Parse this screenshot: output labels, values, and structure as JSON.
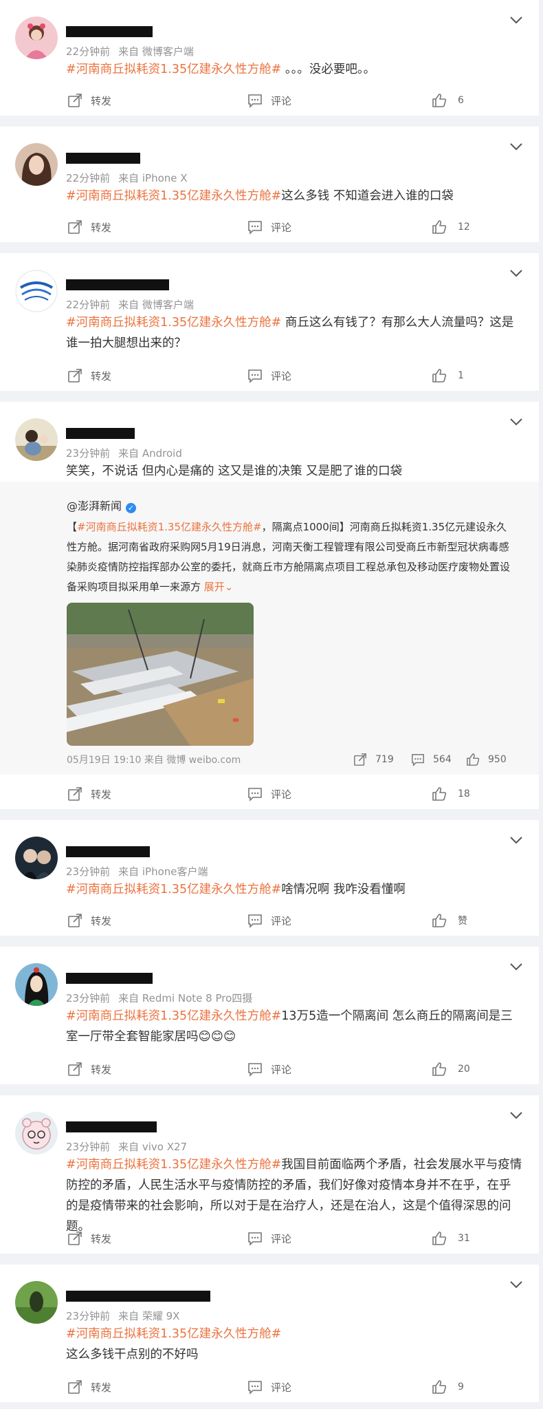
{
  "labels": {
    "share": "转发",
    "comment": "评论"
  },
  "colors": {
    "tag": "#eb7340",
    "meta": "#939393",
    "card": "#ffffff",
    "bg": "#f1f2f5"
  },
  "posts": [
    {
      "time": "22分钟前",
      "source": "来自 微博客户端",
      "tag": "#河南商丘拟耗资1.35亿建永久性方舱#",
      "text": " 。。。没必要吧。。",
      "likes": "6"
    },
    {
      "time": "22分钟前",
      "source": "来自 iPhone X",
      "tag": "#河南商丘拟耗资1.35亿建永久性方舱#",
      "text": "这么多钱 不知道会进入谁的口袋",
      "likes": "12"
    },
    {
      "time": "22分钟前",
      "source": "来自 微博客户端",
      "tag": "#河南商丘拟耗资1.35亿建永久性方舱#",
      "text": " 商丘这么有钱了？有那么大人流量吗？这是谁一拍大腿想出来的？",
      "likes": "1"
    },
    {
      "time": "23分钟前",
      "source": "来自 Android",
      "tag": "",
      "text": "笑笑，不说话 但内心是痛的 这又是谁的决策 又是肥了谁的口袋",
      "likes": "18",
      "repost": {
        "author": "@澎湃新闻",
        "verified": "✓",
        "text_pre": "【",
        "tag": "#河南商丘拟耗资1.35亿建永久性方舱#",
        "text": "，隔离点1000间】河南商丘拟耗资1.35亿元建设永久性方舱。据河南省政府采购网5月19日消息，河南天衡工程管理有限公司受商丘市新型冠状病毒感染肺炎疫情防控指挥部办公室的委托，就商丘市方舱隔离点项目工程总承包及移动医疗废物处置设备采购项目拟采用单一来源方 ",
        "expand": "展开",
        "meta": "05月19日 19:10 来自 微博 weibo.com",
        "shares": "719",
        "comments": "564",
        "likes": "950"
      }
    },
    {
      "time": "23分钟前",
      "source": "来自 iPhone客户端",
      "tag": "#河南商丘拟耗资1.35亿建永久性方舱#",
      "text": "啥情况啊 我咋没看懂啊",
      "likes": "赞"
    },
    {
      "time": "23分钟前",
      "source": "来自 Redmi Note 8 Pro四摄",
      "tag": "#河南商丘拟耗资1.35亿建永久性方舱#",
      "text": "13万5造一个隔离间 怎么商丘的隔离间是三室一厅带全套智能家居吗😊😊😊",
      "likes": "20"
    },
    {
      "time": "23分钟前",
      "source": "来自 vivo X27",
      "tag": "#河南商丘拟耗资1.35亿建永久性方舱#",
      "text": "我国目前面临两个矛盾，社会发展水平与疫情防控的矛盾，人民生活水平与疫情防控的矛盾，我们好像对疫情本身并不在乎，在乎的是疫情带来的社会影响，所以对于是在治疗人，还是在治人，这是个值得深思的问题。",
      "likes": "31"
    },
    {
      "time": "23分钟前",
      "source": "来自 荣耀 9X",
      "tag": "#河南商丘拟耗资1.35亿建永久性方舱#",
      "text": "这么多钱干点别的不好吗",
      "likes": "9"
    }
  ]
}
